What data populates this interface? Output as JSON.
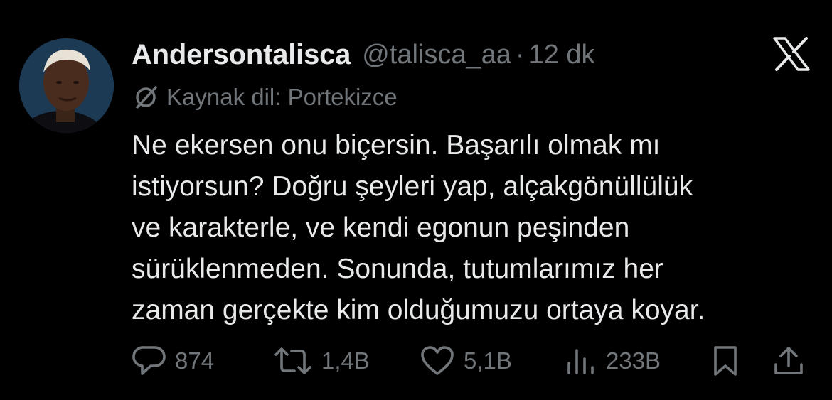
{
  "author": {
    "display_name": "Andersontalisca",
    "handle": "@talisca_aa",
    "separator": "·",
    "time_ago": "12 dk"
  },
  "translation": {
    "icon": "translate-slash-icon",
    "label": "Kaynak dil: Portekizce"
  },
  "tweet": {
    "lines": [
      "Ne ekersen onu biçersin. Başarılı olmak mı",
      "istiyorsun? Doğru şeyleri yap, alçakgönüllülük",
      "ve karakterle, ve kendi egonun peşinden",
      "sürüklenmeden. Sonunda, tutumlarımız her",
      "zaman gerçekte kim olduğumuzu ortaya koyar."
    ]
  },
  "actions": {
    "reply": {
      "icon": "reply-icon",
      "count": "874"
    },
    "retweet": {
      "icon": "retweet-icon",
      "count": "1,4B"
    },
    "like": {
      "icon": "heart-icon",
      "count": "5,1B"
    },
    "views": {
      "icon": "views-icon",
      "count": "233B"
    },
    "bookmark": {
      "icon": "bookmark-icon"
    },
    "share": {
      "icon": "share-icon"
    }
  },
  "brand": {
    "icon": "x-logo-icon"
  },
  "colors": {
    "background": "#000000",
    "primary_text": "#e7e9ea",
    "secondary_text": "#71767b"
  }
}
